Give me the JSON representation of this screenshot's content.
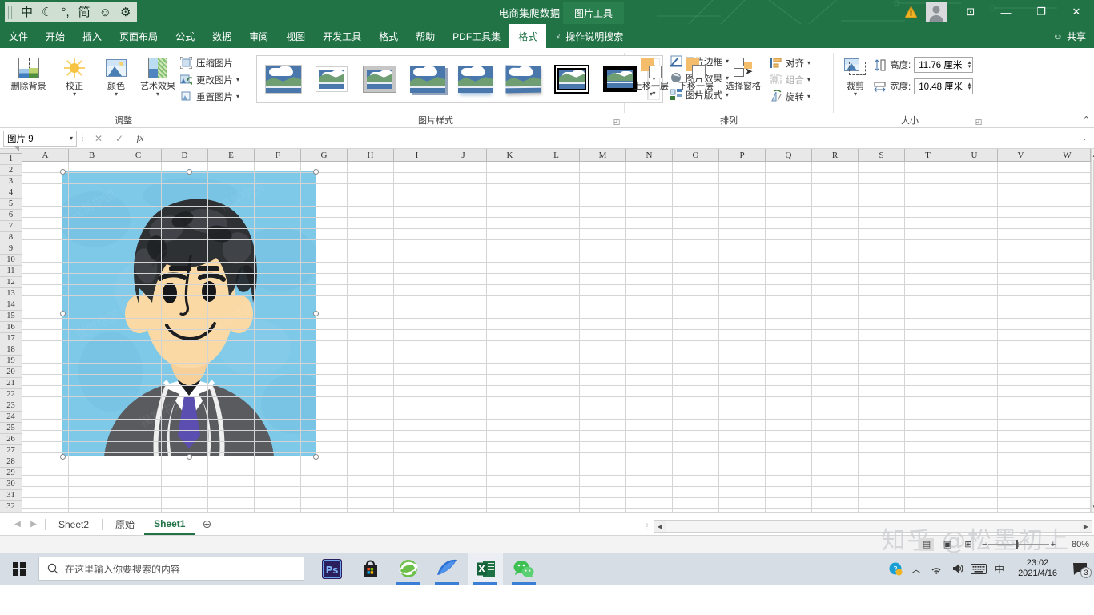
{
  "window": {
    "title": "电商集爬数据  -  Excel",
    "context_tab": "图片工具",
    "ime": {
      "items": [
        "中",
        "☾",
        "°,",
        "简",
        "☺",
        "⚙"
      ]
    },
    "buttons": {
      "warning": "⚠",
      "ribbon_display": "⊡",
      "minimize": "—",
      "restore": "❐",
      "close": "✕"
    },
    "share": "共享",
    "share_icon": "person-share-icon"
  },
  "ribbon": {
    "tabs": [
      {
        "label": "文件",
        "active": false
      },
      {
        "label": "开始",
        "active": false
      },
      {
        "label": "插入",
        "active": false
      },
      {
        "label": "页面布局",
        "active": false
      },
      {
        "label": "公式",
        "active": false
      },
      {
        "label": "数据",
        "active": false
      },
      {
        "label": "审阅",
        "active": false
      },
      {
        "label": "视图",
        "active": false
      },
      {
        "label": "开发工具",
        "active": false
      },
      {
        "label": "格式",
        "active": false
      },
      {
        "label": "帮助",
        "active": false
      },
      {
        "label": "PDF工具集",
        "active": false
      },
      {
        "label": "格式",
        "active": true
      }
    ],
    "tellme": "操作说明搜索",
    "groups": {
      "adjust": {
        "title": "调整",
        "remove_bg": "删除背景",
        "corrections": "校正",
        "color": "颜色",
        "artistic": "艺术效果",
        "compress": "压缩图片",
        "change_pic": "更改图片",
        "reset_pic": "重置图片"
      },
      "styles": {
        "title": "图片样式",
        "picture_border": "图片边框",
        "picture_effects": "图片效果",
        "picture_layout": "图片版式",
        "thumbnails": [
          {
            "name": "plain-style",
            "selected": false
          },
          {
            "name": "white-frame-style",
            "selected": false
          },
          {
            "name": "gray-matte-style",
            "selected": false
          },
          {
            "name": "drop-shadow-style",
            "selected": false
          },
          {
            "name": "reflected-style",
            "selected": false
          },
          {
            "name": "perspective-style",
            "selected": false
          },
          {
            "name": "black-double-frame-style",
            "selected": true
          },
          {
            "name": "thick-black-frame-style",
            "selected": false
          }
        ]
      },
      "arrange": {
        "title": "排列",
        "bring_forward": "上移一层",
        "send_backward": "下移一层",
        "selection_pane": "选择窗格",
        "align": "对齐",
        "group": "组合",
        "rotate": "旋转"
      },
      "size": {
        "title": "大小",
        "crop": "裁剪",
        "height_label": "高度:",
        "height_value": "11.76 厘米",
        "width_label": "宽度:",
        "width_value": "10.48 厘米"
      }
    },
    "collapse": "⌃"
  },
  "formula_bar": {
    "name_box": "图片 9",
    "cancel": "✕",
    "confirm": "✓",
    "fx": "fx",
    "value": "",
    "expand": "⌄"
  },
  "grid": {
    "columns": [
      "A",
      "B",
      "C",
      "D",
      "E",
      "F",
      "G",
      "H",
      "I",
      "J",
      "K",
      "L",
      "M",
      "N",
      "O",
      "P",
      "Q",
      "R",
      "S",
      "T",
      "U",
      "V",
      "W"
    ],
    "rows": [
      1,
      2,
      3,
      4,
      5,
      6,
      7,
      8,
      9,
      10,
      11,
      12,
      13,
      14,
      15,
      16,
      17,
      18,
      19,
      20,
      21,
      22,
      23,
      24,
      25,
      26,
      27,
      28,
      29,
      30,
      31,
      32
    ],
    "selected_object": "图片 9",
    "picture": {
      "name": "cartoon-businessman-avatar",
      "alt": "卡通商务男士头像",
      "background_color": "#7ec8e8",
      "hair_color": "#2e3134",
      "skin_color": "#fbd9a5",
      "suit_color": "#595b5e",
      "tie_color": "#5a4fb0",
      "watermark": "视觉中国"
    }
  },
  "sheet_tabs": {
    "prev": "◀",
    "next": "▶",
    "tabs": [
      {
        "label": "Sheet2",
        "active": false
      },
      {
        "label": "原始",
        "active": false
      },
      {
        "label": "Sheet1",
        "active": true
      }
    ],
    "add": "⊕"
  },
  "scroll": {
    "left_arrow": "◀",
    "right_arrow": "▶",
    "grip": "⋮"
  },
  "status_bar": {
    "views": [
      {
        "name": "normal-view",
        "glyph": "▤",
        "active": true
      },
      {
        "name": "page-layout-view",
        "glyph": "▣",
        "active": false
      },
      {
        "name": "page-break-view",
        "glyph": "⊞",
        "active": false
      }
    ],
    "zoom_minus": "−",
    "zoom_plus": "+",
    "zoom": "80%"
  },
  "watermark": {
    "text": "知乎 @松墨初上"
  },
  "taskbar": {
    "start": "start-button",
    "search_placeholder": "在这里输入你要搜索的内容",
    "search_icon": "search-icon",
    "apps": [
      {
        "name": "photoshop-icon",
        "label": "Ps",
        "active": false,
        "running": false
      },
      {
        "name": "microsoft-store-icon",
        "label": "",
        "active": false,
        "running": false
      },
      {
        "name": "internet-explorer-icon",
        "label": "e",
        "active": false,
        "running": true
      },
      {
        "name": "wireshark-icon",
        "label": "",
        "active": false,
        "running": true
      },
      {
        "name": "excel-icon",
        "label": "X",
        "active": true,
        "running": true
      },
      {
        "name": "wechat-icon",
        "label": "",
        "active": false,
        "running": true
      }
    ],
    "tray": [
      {
        "name": "security-shield-icon",
        "glyph": "◍"
      },
      {
        "name": "show-hidden-icons-icon",
        "glyph": "︿"
      },
      {
        "name": "network-icon",
        "glyph": "◤"
      },
      {
        "name": "volume-icon",
        "glyph": "🔊"
      },
      {
        "name": "keyboard-icon",
        "glyph": "⌨"
      },
      {
        "name": "ime-mode-icon",
        "glyph": "中"
      }
    ],
    "time": "23:02",
    "date": "2021/4/16",
    "notification_count": "3"
  }
}
